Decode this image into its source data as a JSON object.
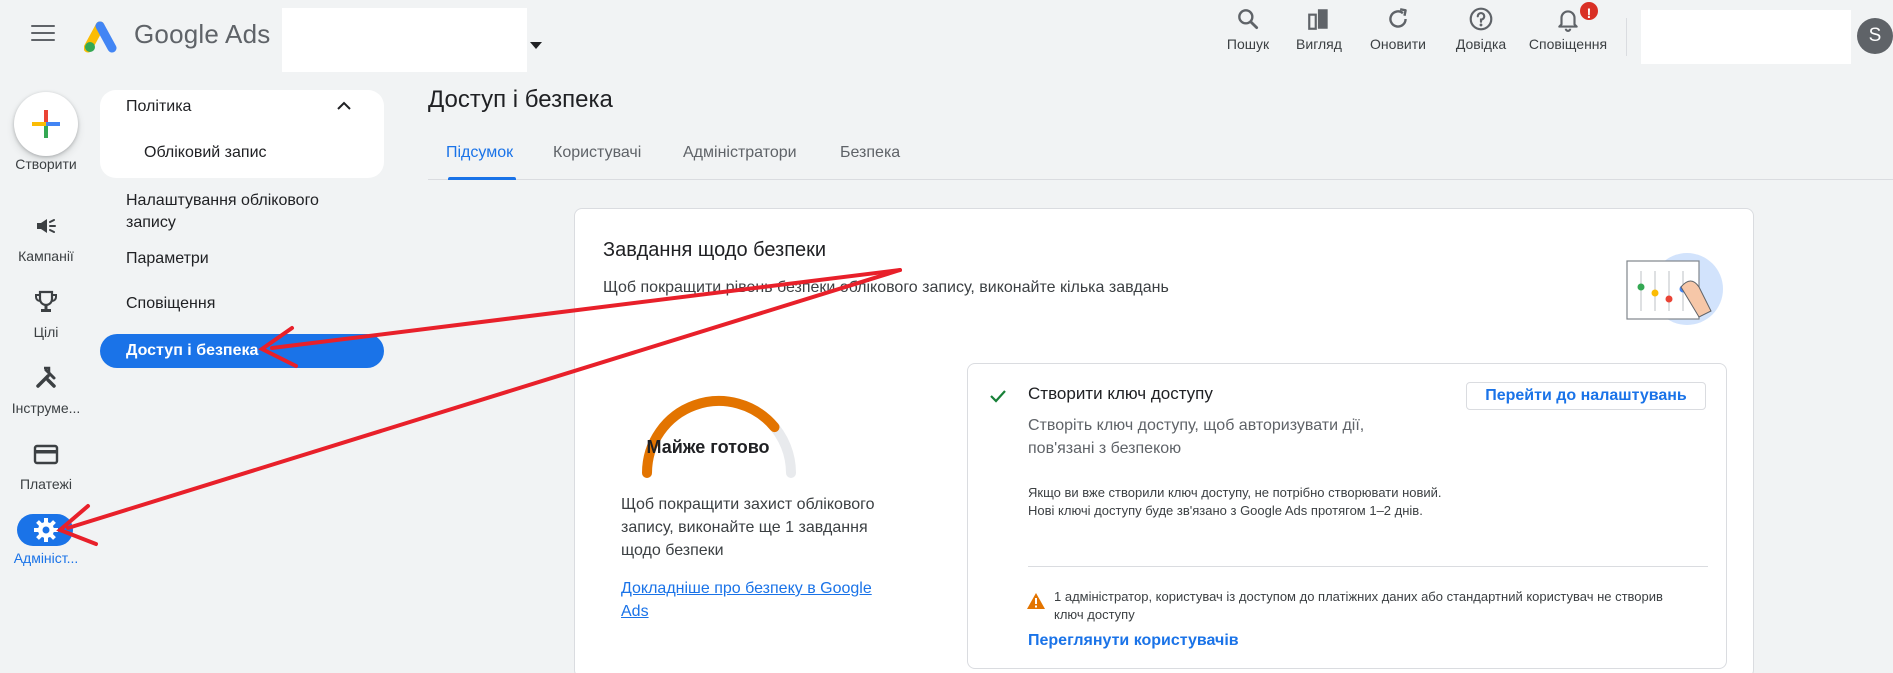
{
  "header": {
    "brand": "Google Ads",
    "tools": [
      {
        "label": "Пошук",
        "icon": "search-icon"
      },
      {
        "label": "Вигляд",
        "icon": "view-icon"
      },
      {
        "label": "Оновити",
        "icon": "refresh-icon"
      },
      {
        "label": "Довідка",
        "icon": "help-icon"
      },
      {
        "label": "Сповіщення",
        "icon": "bell-icon"
      }
    ],
    "notification_badge": "!",
    "avatar_letter": "S"
  },
  "rail": {
    "create_label": "Створити",
    "items": [
      {
        "label": "Кампанії",
        "icon": "megaphone-icon"
      },
      {
        "label": "Цілі",
        "icon": "trophy-icon"
      },
      {
        "label": "Інструме...",
        "icon": "tools-icon"
      },
      {
        "label": "Платежі",
        "icon": "credit-card-icon"
      },
      {
        "label": "Адмініст...",
        "icon": "gear-icon"
      }
    ]
  },
  "subnav": {
    "section": "Політика",
    "account": "Обліковий запис",
    "settings_line1": "Налаштування облікового",
    "settings_line2": "запису",
    "params": "Параметри",
    "notifications": "Сповіщення",
    "active": "Доступ і безпека"
  },
  "main": {
    "title": "Доступ і безпека",
    "tabs": [
      "Підсумок",
      "Користувачі",
      "Адміністратори",
      "Безпека"
    ],
    "active_tab": "Підсумок"
  },
  "card": {
    "title": "Завдання щодо безпеки",
    "subtitle": "Щоб покращити рівень безпеки облікового запису, виконайте кілька завдань",
    "gauge_label": "Майже готово",
    "gauge_progress": 0.78,
    "left_desc": "Щоб покращити захист облікового запису, виконайте ще 1 завдання щодо безпеки",
    "left_link": "Докладніше про безпеку в Google Ads",
    "task": {
      "title": "Створити ключ доступу",
      "desc": "Створіть ключ доступу, щоб авторизувати дії, пов'язані з безпекою",
      "note1": "Якщо ви вже створили ключ доступу, не потрібно створювати новий.",
      "note2": "Нові ключі доступу буде зв'язано з Google Ads протягом 1–2 днів.",
      "button": "Перейти до налаштувань",
      "warning": "1 адміністратор, користувач із доступом до платіжних даних або стандартний користувач не створив ключ доступу",
      "review_link": "Переглянути користувачів"
    }
  },
  "colors": {
    "accent": "#1a73e8",
    "gauge": "#e37400",
    "annotation": "#e8202a",
    "check": "#188038",
    "warning": "#e37400"
  }
}
